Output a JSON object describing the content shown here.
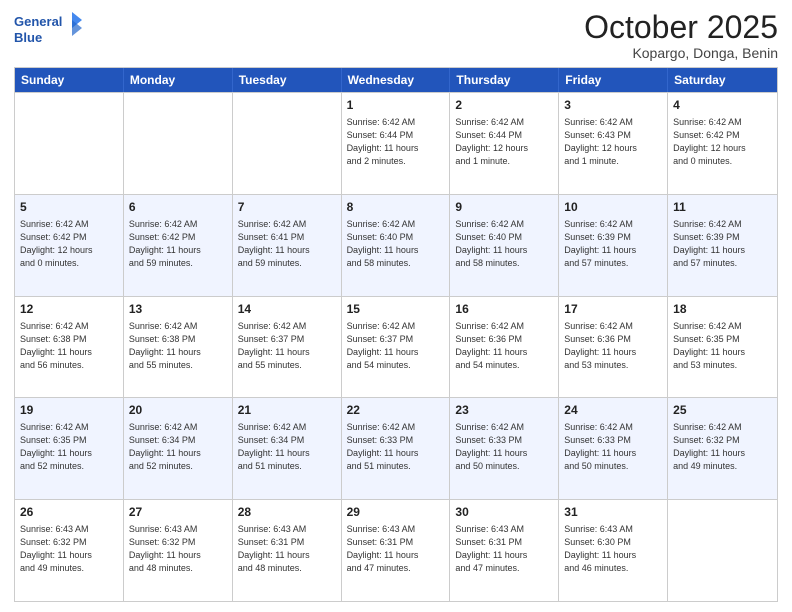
{
  "header": {
    "logo_line1": "General",
    "logo_line2": "Blue",
    "title": "October 2025",
    "subtitle": "Kopargo, Donga, Benin"
  },
  "days_of_week": [
    "Sunday",
    "Monday",
    "Tuesday",
    "Wednesday",
    "Thursday",
    "Friday",
    "Saturday"
  ],
  "rows": [
    {
      "alt": false,
      "cells": [
        {
          "day": "",
          "info": ""
        },
        {
          "day": "",
          "info": ""
        },
        {
          "day": "",
          "info": ""
        },
        {
          "day": "1",
          "info": "Sunrise: 6:42 AM\nSunset: 6:44 PM\nDaylight: 11 hours\nand 2 minutes."
        },
        {
          "day": "2",
          "info": "Sunrise: 6:42 AM\nSunset: 6:44 PM\nDaylight: 12 hours\nand 1 minute."
        },
        {
          "day": "3",
          "info": "Sunrise: 6:42 AM\nSunset: 6:43 PM\nDaylight: 12 hours\nand 1 minute."
        },
        {
          "day": "4",
          "info": "Sunrise: 6:42 AM\nSunset: 6:42 PM\nDaylight: 12 hours\nand 0 minutes."
        }
      ]
    },
    {
      "alt": true,
      "cells": [
        {
          "day": "5",
          "info": "Sunrise: 6:42 AM\nSunset: 6:42 PM\nDaylight: 12 hours\nand 0 minutes."
        },
        {
          "day": "6",
          "info": "Sunrise: 6:42 AM\nSunset: 6:42 PM\nDaylight: 11 hours\nand 59 minutes."
        },
        {
          "day": "7",
          "info": "Sunrise: 6:42 AM\nSunset: 6:41 PM\nDaylight: 11 hours\nand 59 minutes."
        },
        {
          "day": "8",
          "info": "Sunrise: 6:42 AM\nSunset: 6:40 PM\nDaylight: 11 hours\nand 58 minutes."
        },
        {
          "day": "9",
          "info": "Sunrise: 6:42 AM\nSunset: 6:40 PM\nDaylight: 11 hours\nand 58 minutes."
        },
        {
          "day": "10",
          "info": "Sunrise: 6:42 AM\nSunset: 6:39 PM\nDaylight: 11 hours\nand 57 minutes."
        },
        {
          "day": "11",
          "info": "Sunrise: 6:42 AM\nSunset: 6:39 PM\nDaylight: 11 hours\nand 57 minutes."
        }
      ]
    },
    {
      "alt": false,
      "cells": [
        {
          "day": "12",
          "info": "Sunrise: 6:42 AM\nSunset: 6:38 PM\nDaylight: 11 hours\nand 56 minutes."
        },
        {
          "day": "13",
          "info": "Sunrise: 6:42 AM\nSunset: 6:38 PM\nDaylight: 11 hours\nand 55 minutes."
        },
        {
          "day": "14",
          "info": "Sunrise: 6:42 AM\nSunset: 6:37 PM\nDaylight: 11 hours\nand 55 minutes."
        },
        {
          "day": "15",
          "info": "Sunrise: 6:42 AM\nSunset: 6:37 PM\nDaylight: 11 hours\nand 54 minutes."
        },
        {
          "day": "16",
          "info": "Sunrise: 6:42 AM\nSunset: 6:36 PM\nDaylight: 11 hours\nand 54 minutes."
        },
        {
          "day": "17",
          "info": "Sunrise: 6:42 AM\nSunset: 6:36 PM\nDaylight: 11 hours\nand 53 minutes."
        },
        {
          "day": "18",
          "info": "Sunrise: 6:42 AM\nSunset: 6:35 PM\nDaylight: 11 hours\nand 53 minutes."
        }
      ]
    },
    {
      "alt": true,
      "cells": [
        {
          "day": "19",
          "info": "Sunrise: 6:42 AM\nSunset: 6:35 PM\nDaylight: 11 hours\nand 52 minutes."
        },
        {
          "day": "20",
          "info": "Sunrise: 6:42 AM\nSunset: 6:34 PM\nDaylight: 11 hours\nand 52 minutes."
        },
        {
          "day": "21",
          "info": "Sunrise: 6:42 AM\nSunset: 6:34 PM\nDaylight: 11 hours\nand 51 minutes."
        },
        {
          "day": "22",
          "info": "Sunrise: 6:42 AM\nSunset: 6:33 PM\nDaylight: 11 hours\nand 51 minutes."
        },
        {
          "day": "23",
          "info": "Sunrise: 6:42 AM\nSunset: 6:33 PM\nDaylight: 11 hours\nand 50 minutes."
        },
        {
          "day": "24",
          "info": "Sunrise: 6:42 AM\nSunset: 6:33 PM\nDaylight: 11 hours\nand 50 minutes."
        },
        {
          "day": "25",
          "info": "Sunrise: 6:42 AM\nSunset: 6:32 PM\nDaylight: 11 hours\nand 49 minutes."
        }
      ]
    },
    {
      "alt": false,
      "cells": [
        {
          "day": "26",
          "info": "Sunrise: 6:43 AM\nSunset: 6:32 PM\nDaylight: 11 hours\nand 49 minutes."
        },
        {
          "day": "27",
          "info": "Sunrise: 6:43 AM\nSunset: 6:32 PM\nDaylight: 11 hours\nand 48 minutes."
        },
        {
          "day": "28",
          "info": "Sunrise: 6:43 AM\nSunset: 6:31 PM\nDaylight: 11 hours\nand 48 minutes."
        },
        {
          "day": "29",
          "info": "Sunrise: 6:43 AM\nSunset: 6:31 PM\nDaylight: 11 hours\nand 47 minutes."
        },
        {
          "day": "30",
          "info": "Sunrise: 6:43 AM\nSunset: 6:31 PM\nDaylight: 11 hours\nand 47 minutes."
        },
        {
          "day": "31",
          "info": "Sunrise: 6:43 AM\nSunset: 6:30 PM\nDaylight: 11 hours\nand 46 minutes."
        },
        {
          "day": "",
          "info": ""
        }
      ]
    }
  ]
}
